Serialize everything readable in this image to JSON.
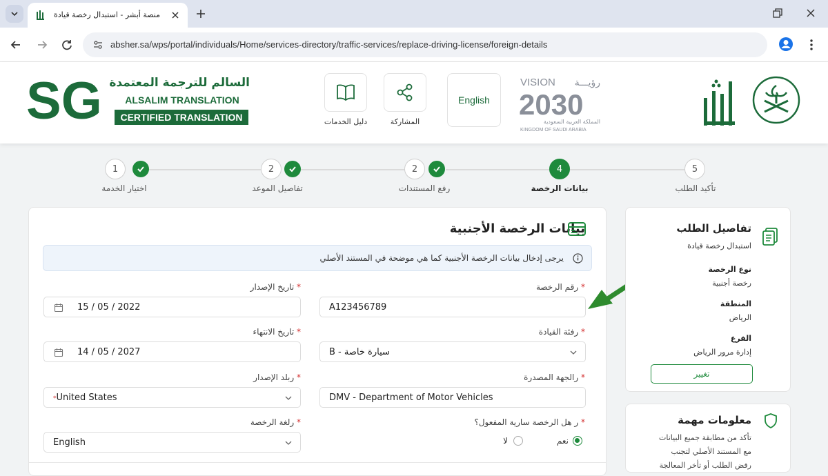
{
  "browser": {
    "tab_title": "منصة أبشر - استبدال رخصة قيادة",
    "url": "absher.sa/wps/portal/individuals/Home/services-directory/traffic-services/replace-driving-license/foreign-details"
  },
  "header": {
    "translation_ar": "السالم للترجمة المعتمدة",
    "translation_en_1": "ALSALIM TRANSLATION",
    "translation_en_2": "CERTIFIED TRANSLATION",
    "sg_letters": "SG",
    "services_guide_label": "دليل الخدمات",
    "share_label": "المشاركة",
    "language_button": "English",
    "vision_word": "VISION",
    "vision_ar": "رؤيـــة",
    "vision_year": "2030",
    "vision_kingdom_ar": "المملكة العربية السعودية",
    "vision_kingdom_en": "KINGDOM OF SAUDI ARABIA",
    "absher_logo_text": "أبشر"
  },
  "steps": [
    {
      "number": "1",
      "label": "اختيار الخدمة",
      "status": "done"
    },
    {
      "number": "2",
      "label": "تفاصيل الموعد",
      "status": "done"
    },
    {
      "number": "2",
      "label": "رفع المستندات",
      "status": "done"
    },
    {
      "number": "4",
      "label": "بيانات الرخصة",
      "status": "active"
    },
    {
      "number": "5",
      "label": "تأكيد الطلب",
      "status": "pending"
    }
  ],
  "form": {
    "title": "بيانات الرخصة الأجنبية",
    "info": "يرجى إدخال بيانات الرخصة الأجنبية كما هي موضحة في المستند الأصلي",
    "license_number_label": "رقم الرخصة",
    "license_number_value": "A123456789",
    "issue_date_label": "تاريخ الإصدار",
    "issue_date_value": "15 / 05 / 2022",
    "license_class_label": "رفئة القيادة",
    "license_class_value": "سيارة خاصة - B",
    "expiry_date_label": "تاريخ الانتهاء",
    "expiry_date_value": "14 / 05 / 2027",
    "issuing_authority_label": "رالجهة المصدرة",
    "issuing_authority_value": "DMV - Department of Motor Vehicles",
    "issue_country_label": "ربلد الإصدار",
    "issue_country_value": "United States",
    "validity_question": "ر هل الرخصة سارية المفعول؟",
    "yes_label": "نعم",
    "no_label": "لا",
    "license_language_label": "رلغة الرخصة",
    "license_language_value": "English",
    "required_mark": "*"
  },
  "sidebar": {
    "title": "تفاصيل الطلب",
    "service": "استبدال رخصة قيادة",
    "license_type_label": "نوع الرخصة",
    "license_type_value": "رخصة أجنبية",
    "region_label": "المنطقة",
    "region_value": "الرياض",
    "branch_label": "الفرع",
    "branch_value": "إدارة مرور الرياض",
    "change_button": "تغيير"
  },
  "notes": {
    "title": "معلومات مهمة",
    "lines": [
      "تأكد من مطابقة جميع البيانات",
      "مع المستند الأصلي لتجنب",
      "رفض الطلب أو تأخر المعالجة"
    ]
  },
  "colors": {
    "accent": "#1e8a3c",
    "brand": "#1c6b3a",
    "info_bg": "#eef4fb"
  }
}
